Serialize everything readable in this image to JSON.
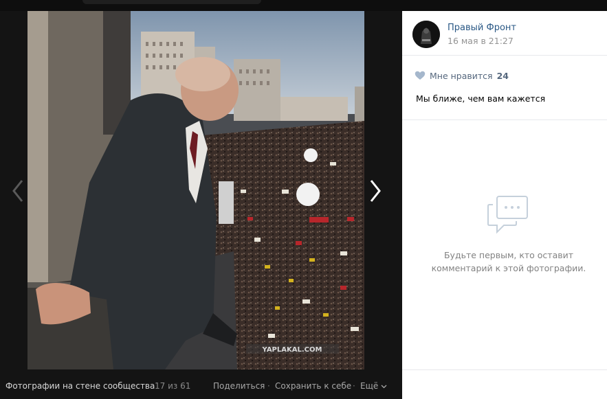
{
  "viewer": {
    "album_title": "Фотографии на стене сообщества",
    "position": "17 из 61",
    "share_label": "Поделиться",
    "save_label": "Сохранить к себе",
    "more_label": "Ещё",
    "separator": "·",
    "watermark": "YAPLAKAL.COM"
  },
  "post": {
    "author": "Правый Фронт",
    "date": "16 мая в 21:27",
    "like_label": "Мне нравится",
    "like_count": "24",
    "caption": "Мы ближе, чем вам кажется"
  },
  "comments": {
    "empty_line1": "Будьте первым, кто оставит",
    "empty_line2": "комментарий к этой фотографии."
  },
  "colors": {
    "link": "#2a5885",
    "muted": "#939393",
    "viewer_bg": "#141414",
    "panel_bg": "#ffffff"
  }
}
